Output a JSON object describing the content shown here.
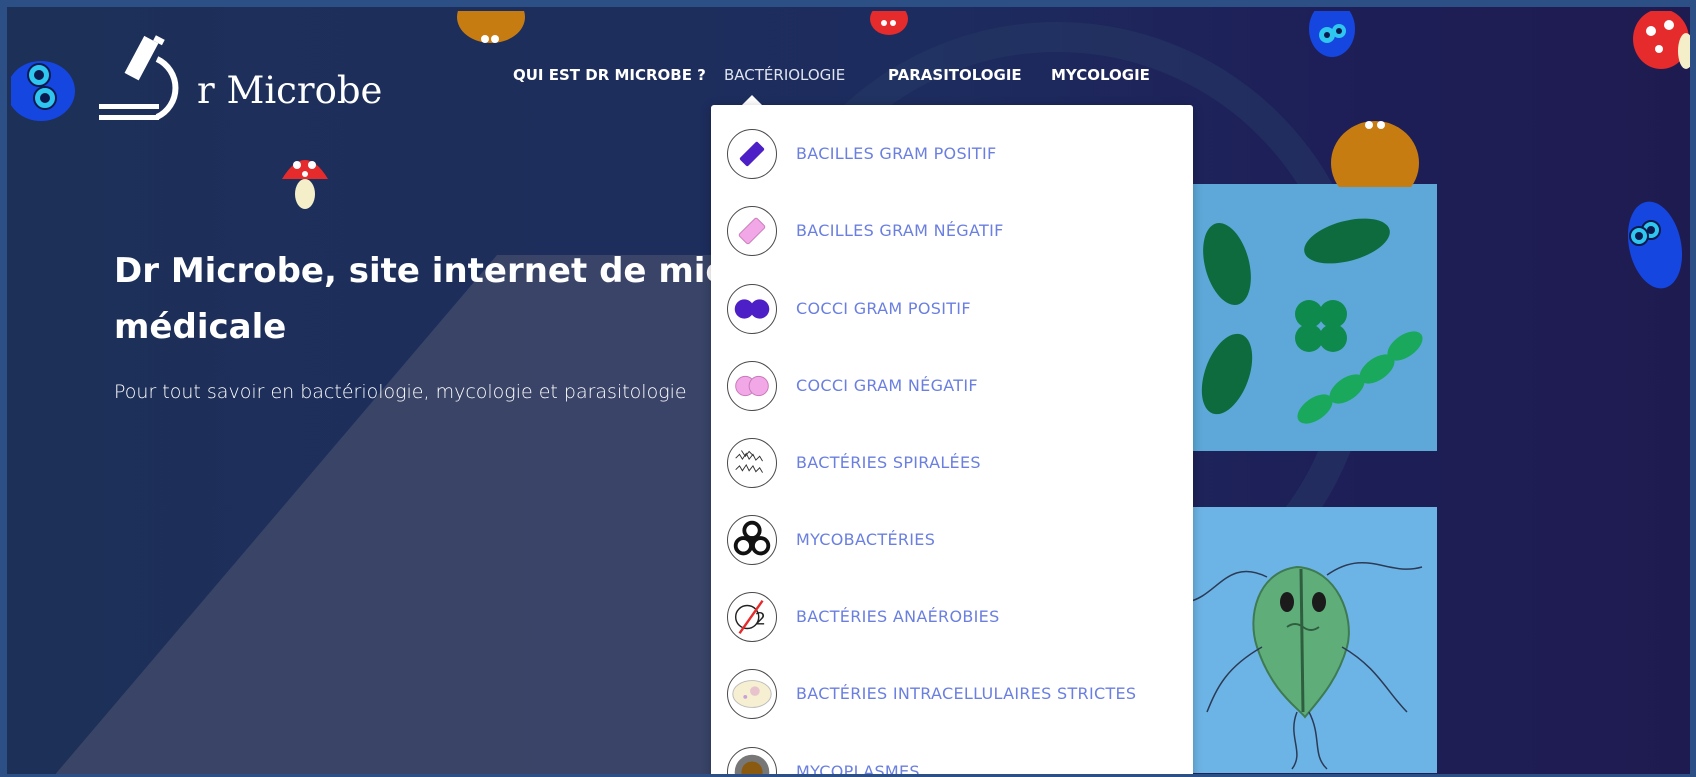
{
  "site": {
    "logo_text": "r Microbe"
  },
  "nav": {
    "items": [
      {
        "label": "QUI EST DR MICROBE ?"
      },
      {
        "label": "BACTÉRIOLOGIE"
      },
      {
        "label": "PARASITOLOGIE"
      },
      {
        "label": "MYCOLOGIE"
      }
    ],
    "active": "BACTÉRIOLOGIE"
  },
  "hero": {
    "title_line1": "Dr Microbe, site internet de micro",
    "title_line2": "médicale",
    "subtitle": "Pour tout savoir en bactériologie, mycologie et parasitologie"
  },
  "dropdown": {
    "items": [
      {
        "label": "BACILLES GRAM POSITIF",
        "icon": "purple-bacillus-icon"
      },
      {
        "label": "BACILLES GRAM NÉGATIF",
        "icon": "pink-bacillus-icon"
      },
      {
        "label": "COCCI GRAM POSITIF",
        "icon": "purple-diplococcus-icon"
      },
      {
        "label": "COCCI GRAM NÉGATIF",
        "icon": "pink-diplococcus-icon"
      },
      {
        "label": "BACTÉRIES SPIRALÉES",
        "icon": "spiral-bacteria-icon"
      },
      {
        "label": "MYCOBACTÉRIES",
        "icon": "biohazard-icon"
      },
      {
        "label": "BACTÉRIES ANAÉROBIES",
        "icon": "no-oxygen-icon"
      },
      {
        "label": "BACTÉRIES INTRACELLULAIRES STRICTES",
        "icon": "cell-icon"
      },
      {
        "label": "MYCOPLASMES",
        "icon": "mycoplasma-icon"
      }
    ]
  },
  "colors": {
    "background": "#1d3058",
    "accent_link": "#6a7fe0",
    "card": "#5da8d9"
  }
}
